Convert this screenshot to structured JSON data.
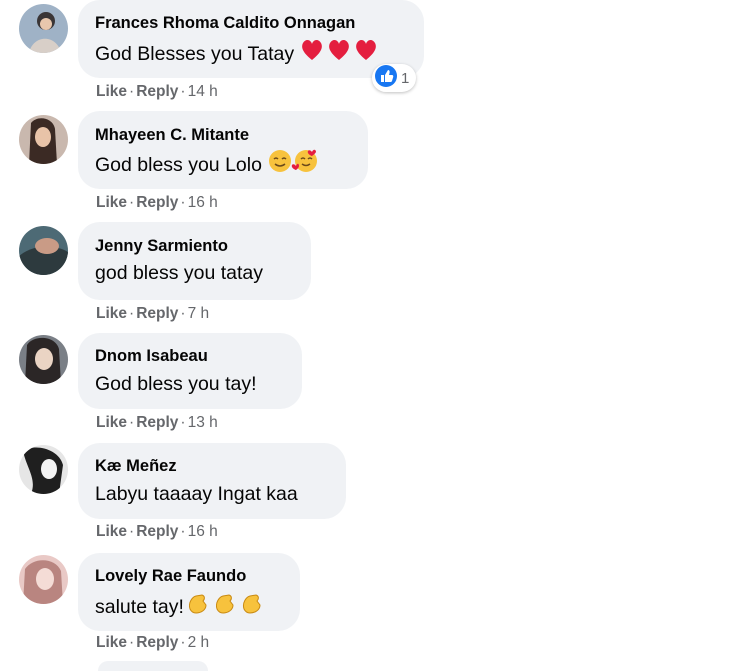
{
  "comments": [
    {
      "author": "Frances Rhoma Caldito Onnagan",
      "text": "God Blesses you Tatay",
      "like": "Like",
      "reply": "Reply",
      "time": "14 h",
      "reaction_count": "1",
      "emoji": "heart-emoji x3"
    },
    {
      "author": "Mhayeen C. Mitante",
      "text": "God bless you Lolo",
      "like": "Like",
      "reply": "Reply",
      "time": "16 h",
      "emoji": "smiling-face-with-hearts-emoji x2"
    },
    {
      "author": "Jenny Sarmiento",
      "text": "god bless you tatay",
      "like": "Like",
      "reply": "Reply",
      "time": "7 h"
    },
    {
      "author": "Dnom Isabeau",
      "text": "God bless you tay!",
      "like": "Like",
      "reply": "Reply",
      "time": "13 h"
    },
    {
      "author": "Kæ Meñez",
      "text": "Labyu taaaay Ingat kaa",
      "like": "Like",
      "reply": "Reply",
      "time": "16 h"
    },
    {
      "author": "Lovely Rae Faundo",
      "text": "salute tay!",
      "like": "Like",
      "reply": "Reply",
      "time": "2 h",
      "emoji": "clapping-hands-emoji x3"
    }
  ],
  "colors": {
    "bubble": "#f0f2f5",
    "secondary_text": "#65676b",
    "like_blue": "#1877f2",
    "heart_red": "#e41e3f"
  }
}
